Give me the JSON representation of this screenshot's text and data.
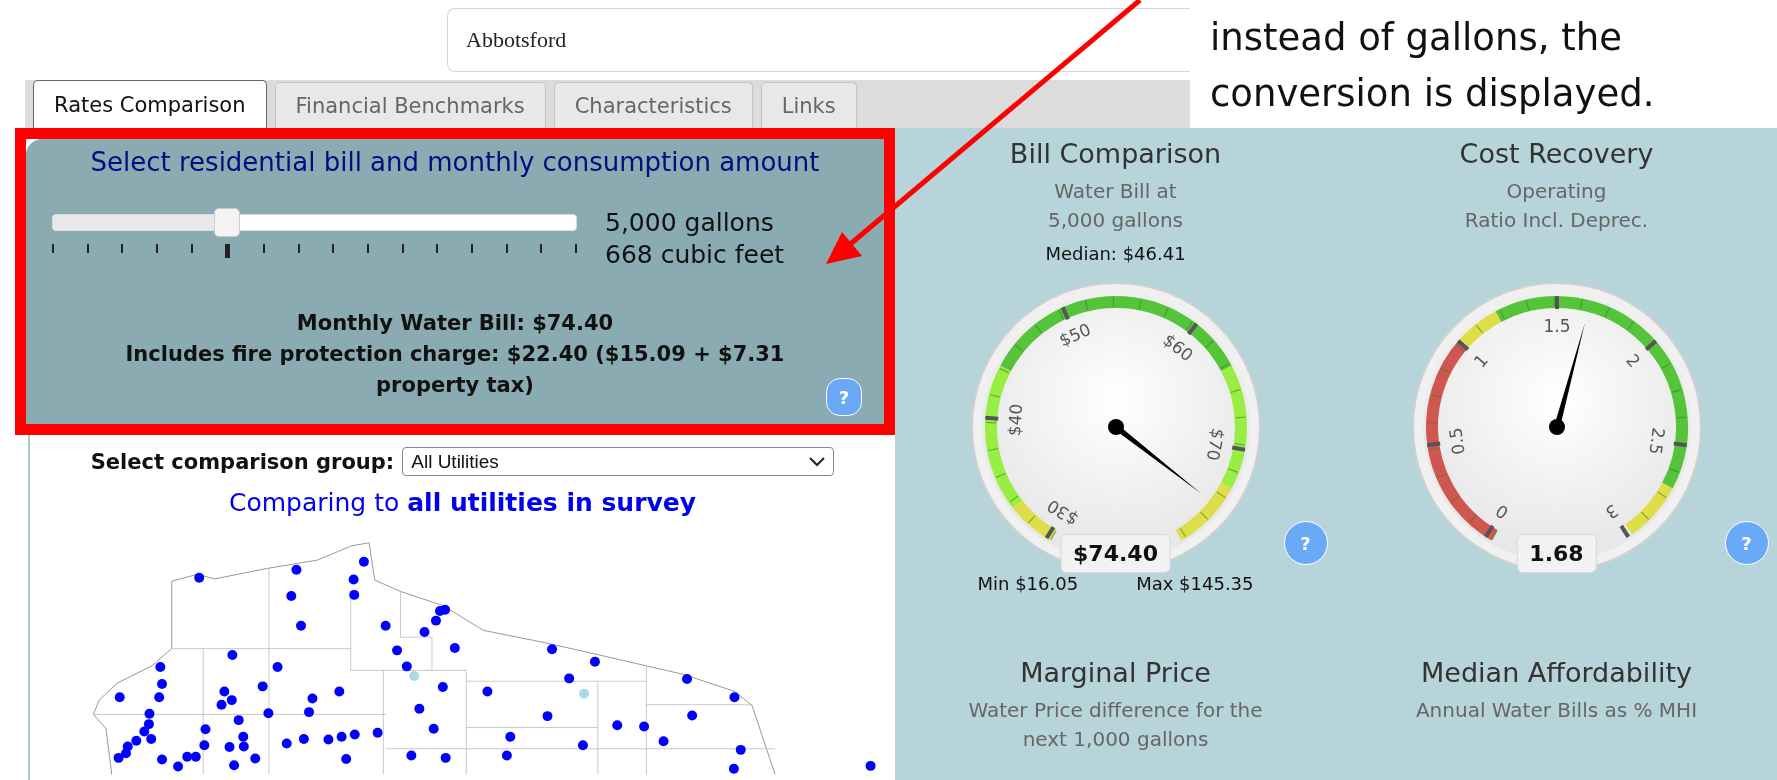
{
  "search": {
    "value": "Abbotsford"
  },
  "annotation": {
    "lines": [
      "instead of gallons, the",
      "conversion is displayed."
    ]
  },
  "tabs": [
    {
      "label": "Rates Comparison",
      "selected": true
    },
    {
      "label": "Financial Benchmarks",
      "selected": false
    },
    {
      "label": "Characteristics",
      "selected": false
    },
    {
      "label": "Links",
      "selected": false
    }
  ],
  "consumption_panel": {
    "title": "Select residential bill and monthly consumption amount",
    "slider": {
      "level": 0.333
    },
    "gallons": "5,000 gallons",
    "cubic_feet": "668 cubic feet",
    "bill": "Monthly Water Bill: $74.40",
    "fire_charge": "Includes fire protection charge: $22.40 ($15.09 + $7.31 property tax)",
    "help": "?"
  },
  "comparison": {
    "label": "Select comparison group:",
    "group": "All Utilities",
    "caption": "Comparing to **all utilities in survey**"
  },
  "gauges": [
    {
      "kind": "bill",
      "title": "Bill Comparison",
      "subtitle_lines": [
        "Water Bill at",
        "5,000 gallons"
      ],
      "median": "Median: $46.41",
      "scale_labels": [
        "$30",
        "$40",
        "$50",
        "$60",
        "$70"
      ],
      "value": "$74.40",
      "min": "Min $16.05",
      "max": "Max $145.35",
      "help": "?"
    },
    {
      "kind": "ratio",
      "title": "Cost Recovery",
      "subtitle_lines": [
        "Operating",
        "Ratio Incl. Deprec."
      ],
      "scale_labels": [
        "0",
        "0.5",
        "1",
        "1.5",
        "2",
        "2.5",
        "3"
      ],
      "value": "1.68",
      "help": "?"
    }
  ],
  "lower_gauges": [
    {
      "title": "Marginal Price",
      "subtitle_lines": [
        "Water Price difference for the",
        "next 1,000 gallons"
      ]
    },
    {
      "title": "Median Affordability",
      "subtitle_lines": [
        "Annual Water Bills as % MHI"
      ]
    }
  ]
}
